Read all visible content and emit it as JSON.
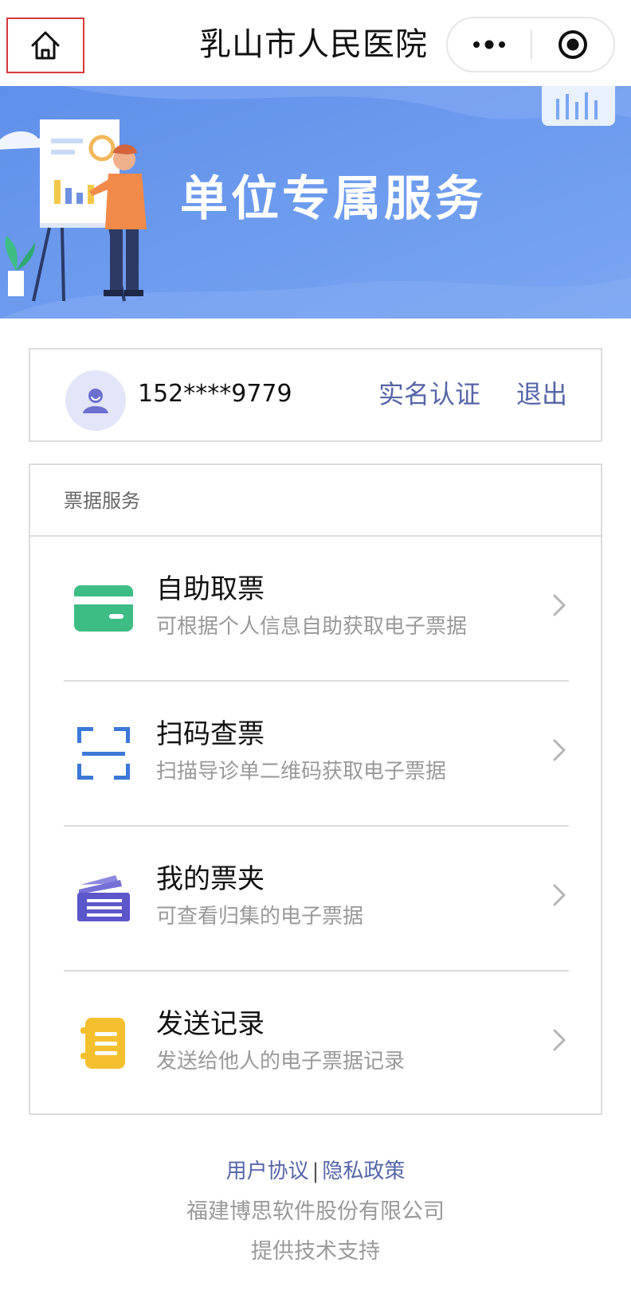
{
  "navbar": {
    "title": "乳山市人民医院",
    "home_icon": "home-icon",
    "more_icon": "more-dots-icon",
    "close_icon": "record-circle-icon"
  },
  "banner": {
    "title": "单位专属服务"
  },
  "user": {
    "phone": "152****9779",
    "verify_label": "实名认证",
    "logout_label": "退出",
    "avatar_icon": "user-avatar-icon"
  },
  "services": {
    "header": "票据服务",
    "items": [
      {
        "title": "自助取票",
        "desc": "可根据个人信息自助获取电子票据",
        "icon": "card-icon",
        "color": "#3dbd84"
      },
      {
        "title": "扫码查票",
        "desc": "扫描导诊单二维码获取电子票据",
        "icon": "scan-icon",
        "color": "#3b78d8"
      },
      {
        "title": "我的票夹",
        "desc": "可查看归集的电子票据",
        "icon": "ticket-folder-icon",
        "color": "#5b56c9"
      },
      {
        "title": "发送记录",
        "desc": "发送给他人的电子票据记录",
        "icon": "record-list-icon",
        "color": "#f5c02f"
      }
    ]
  },
  "footer": {
    "agreement": "用户协议",
    "separator": "|",
    "privacy": "隐私政策",
    "company": "福建博思软件股份有限公司",
    "support": "提供技术支持"
  },
  "colors": {
    "link": "#5566a8",
    "banner_bg": "#6e9cf0",
    "home_highlight_border": "#d63a3a"
  }
}
